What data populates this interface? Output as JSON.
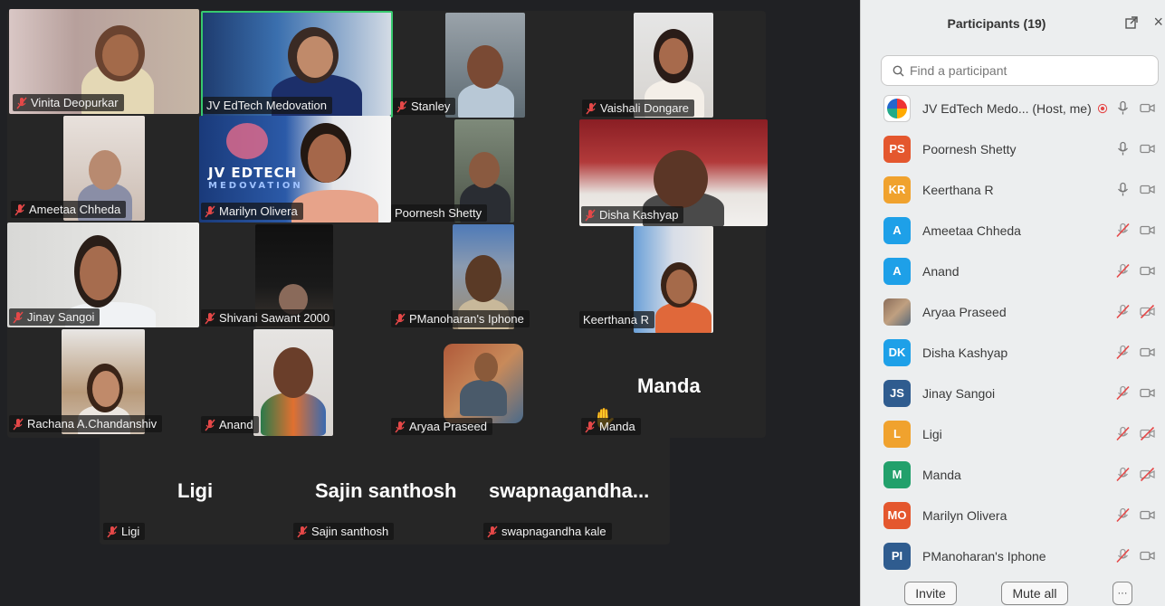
{
  "gallery": {
    "tiles": [
      {
        "name": "Vinita Deopurkar"
      },
      {
        "name": "JV EdTech Medovation"
      },
      {
        "name": "Stanley"
      },
      {
        "name": "Vaishali Dongare"
      },
      {
        "name": "Ameetaa Chheda"
      },
      {
        "name": "Marilyn Olivera"
      },
      {
        "name": "Poornesh Shetty"
      },
      {
        "name": "Disha Kashyap"
      },
      {
        "name": "Jinay Sangoi"
      },
      {
        "name": "Shivani Sawant 2000"
      },
      {
        "name": "PManoharan's Iphone"
      },
      {
        "name": "Keerthana R"
      },
      {
        "name": "Rachana A.Chandanshiv"
      },
      {
        "name": "Anand"
      },
      {
        "name": "Aryaa Praseed"
      },
      {
        "name": "Manda",
        "big": "Manda"
      },
      {
        "name": "Ligi",
        "big": "Ligi"
      },
      {
        "name": "Sajin santhosh",
        "big": "Sajin santhosh"
      },
      {
        "name": "swapnagandha kale",
        "big": "swapnagandha..."
      }
    ],
    "logo_text": [
      "JV EDTECH",
      "MEDOVATION"
    ]
  },
  "panel": {
    "title": "Participants (19)",
    "search_placeholder": "Find a participant",
    "participants": [
      {
        "initials": "",
        "name": "JV EdTech Medo... (Host, me)",
        "color": "#1d3f8c",
        "icon": "logo-avatar",
        "mic": "on",
        "video": "on",
        "recording": true
      },
      {
        "initials": "PS",
        "name": "Poornesh Shetty",
        "color": "#e4572e",
        "mic": "on",
        "video": "on"
      },
      {
        "initials": "KR",
        "name": "Keerthana R",
        "color": "#f0a22e",
        "mic": "on",
        "video": "on"
      },
      {
        "initials": "A",
        "name": "Ameetaa Chheda",
        "color": "#1ea0e8",
        "mic": "off",
        "video": "on"
      },
      {
        "initials": "A",
        "name": "Anand",
        "color": "#1ea0e8",
        "mic": "off",
        "video": "on"
      },
      {
        "initials": "",
        "name": "Aryaa Praseed",
        "color": "#8a6d5a",
        "icon": "photo-avatar",
        "mic": "off",
        "video": "off"
      },
      {
        "initials": "DK",
        "name": "Disha Kashyap",
        "color": "#1ea0e8",
        "mic": "off",
        "video": "on"
      },
      {
        "initials": "JS",
        "name": "Jinay Sangoi",
        "color": "#2f5c8f",
        "mic": "off",
        "video": "on"
      },
      {
        "initials": "L",
        "name": "Ligi",
        "color": "#f0a22e",
        "mic": "off",
        "video": "off"
      },
      {
        "initials": "M",
        "name": "Manda",
        "color": "#22a06b",
        "mic": "off",
        "video": "off"
      },
      {
        "initials": "MO",
        "name": "Marilyn Olivera",
        "color": "#e4572e",
        "mic": "off",
        "video": "on"
      },
      {
        "initials": "PI",
        "name": "PManoharan's Iphone",
        "color": "#2f5c8f",
        "mic": "off",
        "video": "on"
      }
    ],
    "invite_label": "Invite",
    "mute_all_label": "Mute all",
    "more_label": "···"
  }
}
